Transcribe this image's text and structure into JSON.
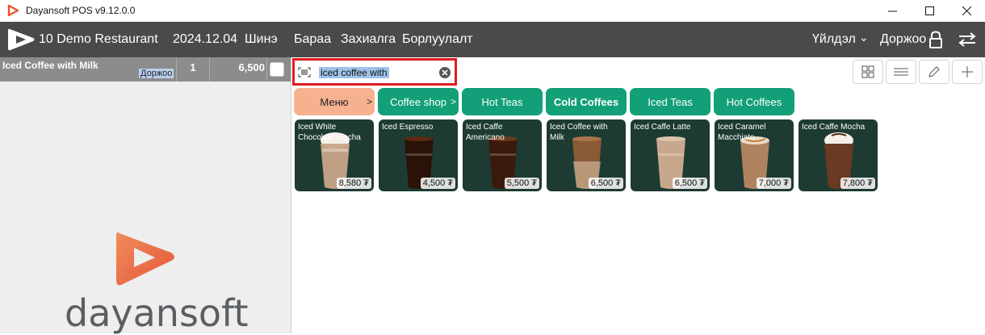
{
  "window": {
    "title": "Dayansoft POS v9.12.0.0"
  },
  "menubar": {
    "restaurant": "10 Demo Restaurant",
    "date": "2024.12.04",
    "items": [
      "Шинэ",
      "Бараа",
      "Захиалга",
      "Борлуулалт"
    ],
    "service": "Үйлдэл",
    "service_caret": "⌄",
    "user": "Доржоо"
  },
  "order": {
    "item_name": "Iced Coffee with Milk",
    "item_tag": "Доржоо",
    "quantity": "1",
    "price": "6,500"
  },
  "brand": {
    "wordmark": "dayansoft"
  },
  "search": {
    "value": "iced coffee with"
  },
  "categories": [
    {
      "label": "Меню",
      "arrow": ">",
      "color": "#f6b28f",
      "text_color": "#222222"
    },
    {
      "label": "Coffee shop",
      "arrow": ">",
      "color": "#13a078",
      "text_color": "#ffffff"
    },
    {
      "label": "Hot Teas",
      "arrow": "",
      "color": "#13a078",
      "text_color": "#ffffff"
    },
    {
      "label": "Cold Coffees",
      "arrow": "",
      "color": "#13a078",
      "text_color": "#ffffff"
    },
    {
      "label": "Iced Teas",
      "arrow": "",
      "color": "#13a078",
      "text_color": "#ffffff"
    },
    {
      "label": "Hot Coffees",
      "arrow": "",
      "color": "#13a078",
      "text_color": "#ffffff"
    }
  ],
  "products": [
    {
      "name": "Iced White Chocolate Mocha",
      "price": "8,580 ₮",
      "drink_color": "#c9a58a"
    },
    {
      "name": "Iced Espresso",
      "price": "4,500 ₮",
      "drink_color": "#2a1208"
    },
    {
      "name": "Iced Caffe Americano",
      "price": "5,500 ₮",
      "drink_color": "#3a1a0c"
    },
    {
      "name": "Iced Coffee with Milk",
      "price": "6,500 ₮",
      "drink_color": "#8a5a35"
    },
    {
      "name": "Iced Caffe Latte",
      "price": "6,500 ₮",
      "drink_color": "#c8a88c"
    },
    {
      "name": "Iced Caramel Macchiato",
      "price": "7,000 ₮",
      "drink_color": "#b08360"
    },
    {
      "name": "Iced Caffe Mocha",
      "price": "7,800 ₮",
      "drink_color": "#6a3a22"
    }
  ],
  "colors": {
    "menubar_bg": "#4a4a4a",
    "accent_green": "#13a078",
    "accent_peach": "#f6b28f",
    "search_border": "#e01b24",
    "product_bg": "#1d3b33"
  }
}
